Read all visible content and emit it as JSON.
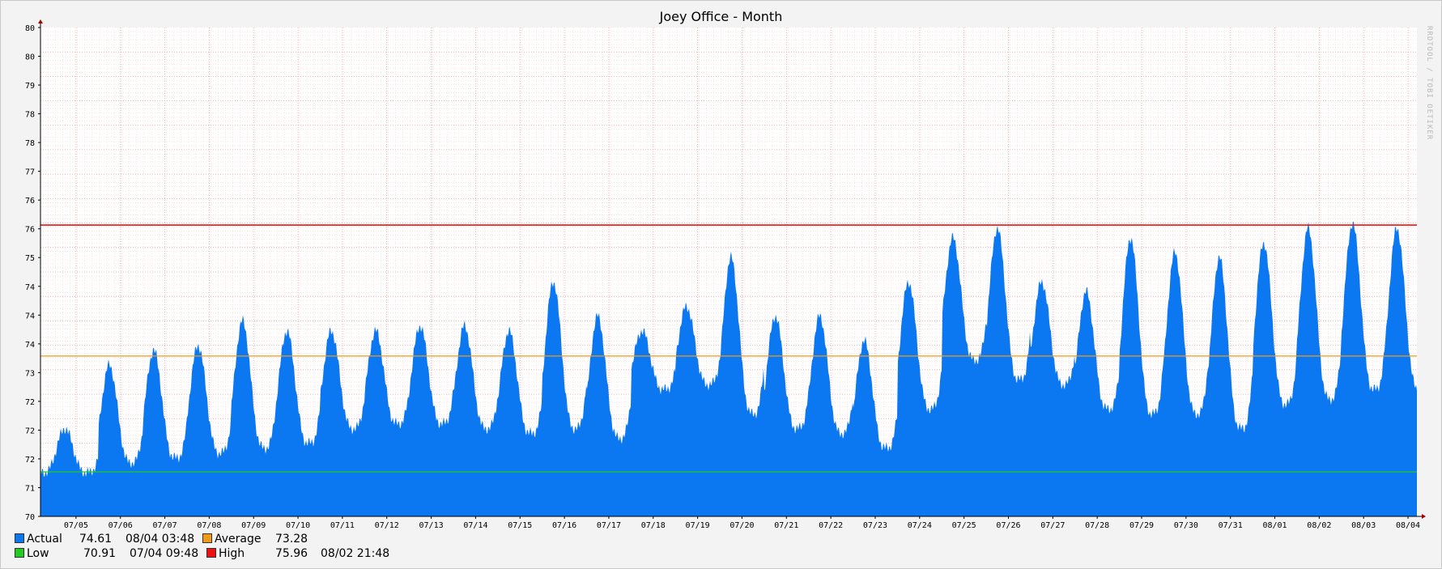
{
  "chart_data": {
    "type": "area",
    "title": "Joey Office - Month",
    "watermark": "RRDTOOL / TOBI OETIKER",
    "y_tick_labels": [
      "70",
      "71",
      "72",
      "72",
      "72",
      "73",
      "74",
      "74",
      "74",
      "75",
      "76",
      "76",
      "77",
      "78",
      "78",
      "79",
      "80",
      "80"
    ],
    "ylim": [
      70,
      80
    ],
    "x_tick_labels": [
      "07/05",
      "07/06",
      "07/07",
      "07/08",
      "07/09",
      "07/10",
      "07/11",
      "07/12",
      "07/13",
      "07/14",
      "07/15",
      "07/16",
      "07/17",
      "07/18",
      "07/19",
      "07/20",
      "07/21",
      "07/22",
      "07/23",
      "07/24",
      "07/25",
      "07/26",
      "07/27",
      "07/28",
      "07/29",
      "07/30",
      "07/31",
      "08/01",
      "08/02",
      "08/03",
      "08/04"
    ],
    "x_range_days": [
      -0.8,
      30.2
    ],
    "grid": true,
    "series": [
      {
        "name": "Actual",
        "color": "#0b78f2",
        "daily_min": [
          70.9,
          71.1,
          71.2,
          71.3,
          71.4,
          71.5,
          71.8,
          71.9,
          71.9,
          71.8,
          71.7,
          71.8,
          71.6,
          72.6,
          72.7,
          72.1,
          71.8,
          71.7,
          71.4,
          72.2,
          73.2,
          72.8,
          72.7,
          72.2,
          72.1,
          72.1,
          71.8,
          72.3,
          72.4,
          72.6,
          72.6
        ],
        "daily_max": [
          71.8,
          73.1,
          73.4,
          73.5,
          74.0,
          73.8,
          73.8,
          73.8,
          73.9,
          73.9,
          73.8,
          74.8,
          74.1,
          73.8,
          74.3,
          75.3,
          74.1,
          74.1,
          73.6,
          74.8,
          75.7,
          75.9,
          74.8,
          74.6,
          75.7,
          75.4,
          75.3,
          75.6,
          75.9,
          76.0,
          75.9
        ]
      },
      {
        "name": "Average",
        "color": "#f09a1a",
        "value": 73.28
      },
      {
        "name": "Low",
        "color": "#22cc22",
        "value": 70.91
      },
      {
        "name": "High",
        "color": "#ee1111",
        "value": 75.96
      }
    ]
  },
  "legend": {
    "actual": {
      "label": "Actual",
      "value": "74.61",
      "time": "08/04 03:48",
      "color": "#0b78f2"
    },
    "average": {
      "label": "Average",
      "value": "73.28",
      "color": "#f09a1a"
    },
    "low": {
      "label": "Low",
      "value": "70.91",
      "time": "07/04 09:48",
      "color": "#22cc22"
    },
    "high": {
      "label": "High",
      "value": "75.96",
      "time": "08/02 21:48",
      "color": "#ee1111"
    }
  }
}
